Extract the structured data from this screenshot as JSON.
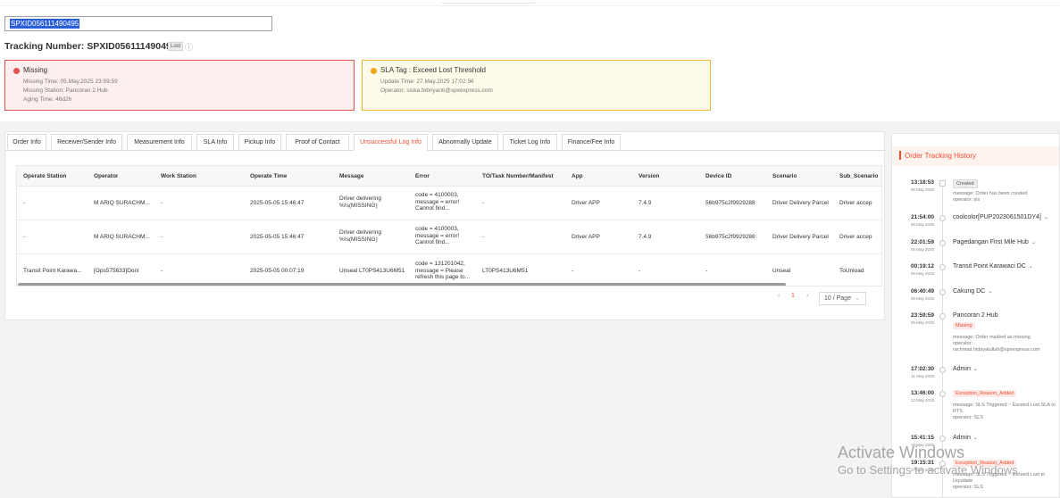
{
  "search": {
    "value": "SPXID056111490495"
  },
  "tracking": {
    "title": "Tracking Number: SPXID056111490495",
    "tag": "Lost",
    "info_icon": "info-circle-icon"
  },
  "alerts": {
    "missing": {
      "title": "Missing",
      "lines": [
        "Missing Time: 05.May.2025 23:59:59",
        "Missing Station: Pancoran 2 Hub",
        "Aging Time: 46d2h"
      ]
    },
    "sla": {
      "title": "SLA Tag : Exceed Lost Threshold",
      "lines": [
        "Update Time: 27.May.2025 17:02:56",
        "Operator: siska.febriyanti@spxexpress.com"
      ]
    }
  },
  "tabs": [
    "Order Info",
    "Receiver/Sender Info",
    "Measurement Info",
    "SLA Info",
    "Pickup Info",
    "Proof of Contact",
    "Unsuccessful Log Info",
    "Abnormally Update",
    "Ticket Log Info",
    "Finance/Fee Info"
  ],
  "table": {
    "headers": [
      "Operate Station",
      "Operator",
      "Work Station",
      "Operate Time",
      "Message",
      "Error",
      "TO/Task Number/Manifest",
      "App",
      "Version",
      "Device ID",
      "Scenario",
      "Sub_Scenario"
    ],
    "rows": [
      [
        "-",
        "M ARIQ SURACHM...",
        "-",
        "2025-05-05 15:46:47",
        "Driver delivering %!s(MISSING)",
        "code = 4100003, message = error! Cannot find...",
        "-",
        "Driver APP",
        "7.4.9",
        "56b975c2f9929288",
        "Driver Delivery Parcel",
        "Driver accep"
      ],
      [
        "-",
        "M ARIQ SURACHM...",
        "-",
        "2025-05-05 15:46:47",
        "Driver delivering %!s(MISSING)",
        "code = 4100003, message = error! Cannot find...",
        "-",
        "Driver APP",
        "7.4.9",
        "56b975c2f9929288",
        "Driver Delivery Parcel",
        "Driver accep"
      ],
      [
        "Transit Point Karawa...",
        "[Ops575633]Doni",
        "-",
        "2025-05-05 00:07:19",
        "Unseal LT0PS413U6M51",
        "code = 131201042, message = Please refresh this page to...",
        "LT0PS413U6M51",
        "-",
        "-",
        "-",
        "Unseal",
        "ToUnload"
      ]
    ]
  },
  "pagination": {
    "prev": "‹",
    "page": "1",
    "next": "›",
    "page_size": "10 / Page",
    "caret": "⌄"
  },
  "history": {
    "title": "Order Tracking History",
    "events": [
      {
        "time": "13:18:53",
        "date": "06 May 2025",
        "loc": "",
        "badge": "Created",
        "badge_type": "grey",
        "msg": "message: Order has been created\noperator: sls"
      },
      {
        "time": "21:54:00",
        "date": "05 May 2025",
        "loc": "coolcolor[PUP2023061501DY4]",
        "caret": "⌄"
      },
      {
        "time": "22:01:59",
        "date": "05 May 2025",
        "loc": "Pagedangan First Mile Hub",
        "caret": "⌄"
      },
      {
        "time": "00:19:12",
        "date": "05 May 2025",
        "loc": "Transit Point Karawaci DC",
        "caret": "⌄"
      },
      {
        "time": "06:40:49",
        "date": "05 May 2025",
        "loc": "Cakung DC",
        "caret": "⌄"
      },
      {
        "time": "23:59:59",
        "date": "05 May 2025",
        "loc": "Pancoran 2 Hub",
        "badge": "Missing",
        "badge_type": "red",
        "msg": "message: Order marked as missing\noperator:\nrachmad.hidayatullah@spxexpress.com"
      },
      {
        "time": "17:02:30",
        "date": "11 May 2025",
        "loc": "Admin",
        "caret": "⌄"
      },
      {
        "time": "13:46:00",
        "date": "12 May 2025",
        "loc": "",
        "badge": "Exception_Reason_Added",
        "badge_type": "red",
        "msg": "message: SLS Triggered ~ Exceed Lost SLA to\nRTS\noperator: SLS"
      },
      {
        "time": "15:41:15",
        "date": "19 May 2025",
        "loc": "Admin",
        "caret": "⌄"
      },
      {
        "time": "19:15:31",
        "date": "27 May 2025",
        "loc": "",
        "badge": "Exception_Reason_Added",
        "badge_type": "red",
        "msg": "message: SLS Triggered ~ Exceed Lost to\nLiquidate\noperator: SLS"
      }
    ]
  },
  "watermark": {
    "line1": "Activate Windows",
    "line2": "Go to Settings to activate Windows."
  }
}
